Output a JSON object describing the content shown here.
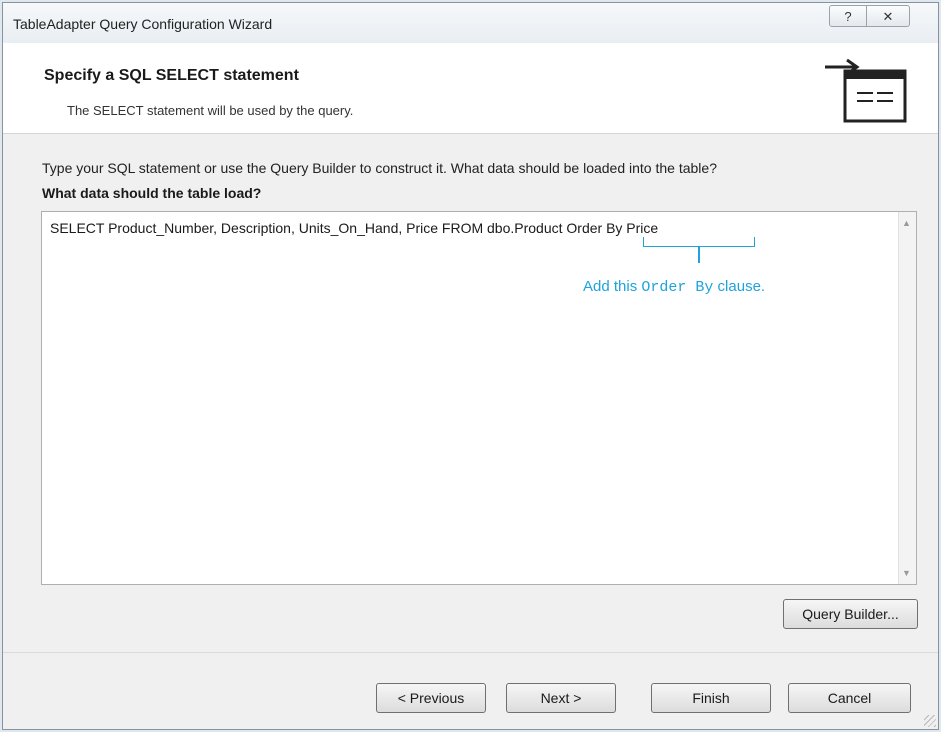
{
  "window": {
    "title": "TableAdapter Query Configuration Wizard",
    "help_label": "?",
    "close_label": "✕"
  },
  "header": {
    "title": "Specify a SQL SELECT statement",
    "subtitle": "The SELECT statement will be used by the query.",
    "icon": "sql-statement-icon"
  },
  "main": {
    "instructions": "Type your SQL statement or use the Query Builder to construct it. What data should be loaded into the table?",
    "question": "What data should the table load?",
    "sql_text": "SELECT Product_Number, Description, Units_On_Hand, Price FROM dbo.Product Order By Price",
    "annotation": {
      "prefix": "Add this ",
      "code": "Order By",
      "suffix": " clause.",
      "color": "#1ea3dc"
    },
    "query_builder_label": "Query Builder..."
  },
  "footer": {
    "previous_label": "< Previous",
    "next_label": "Next >",
    "finish_label": "Finish",
    "cancel_label": "Cancel"
  }
}
